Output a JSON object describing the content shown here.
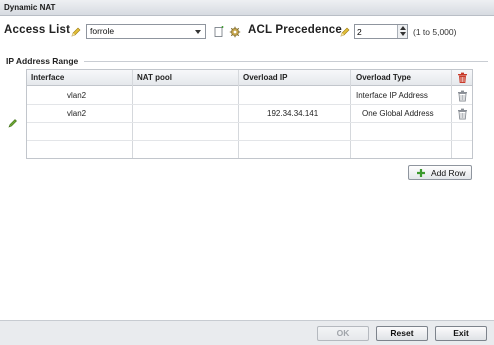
{
  "window": {
    "title": "Dynamic NAT"
  },
  "access_list": {
    "label": "Access List",
    "value": "forrole"
  },
  "acl_precedence": {
    "label": "ACL Precedence",
    "value": "2",
    "range": "(1 to 5,000)"
  },
  "section": {
    "title": "IP Address Range"
  },
  "table": {
    "columns": [
      "Interface",
      "NAT pool",
      "Overload IP",
      "Overload Type"
    ],
    "rows": [
      {
        "interface": "vlan2",
        "nat_pool": "",
        "overload_ip": "",
        "overload_type": "Interface IP Address"
      },
      {
        "interface": "vlan2",
        "nat_pool": "",
        "overload_ip": "192.34.34.141",
        "overload_type": "One Global Address"
      }
    ]
  },
  "buttons": {
    "add_row": "Add Row",
    "ok": "OK",
    "reset": "Reset",
    "exit": "Exit"
  },
  "colors": {
    "pencil": "#c8a21a",
    "edit_pencil": "#5d9a2a",
    "add_plus": "#3c9a2e",
    "trash_header": "#c83a2a",
    "trash_row": "#8a8f96"
  }
}
